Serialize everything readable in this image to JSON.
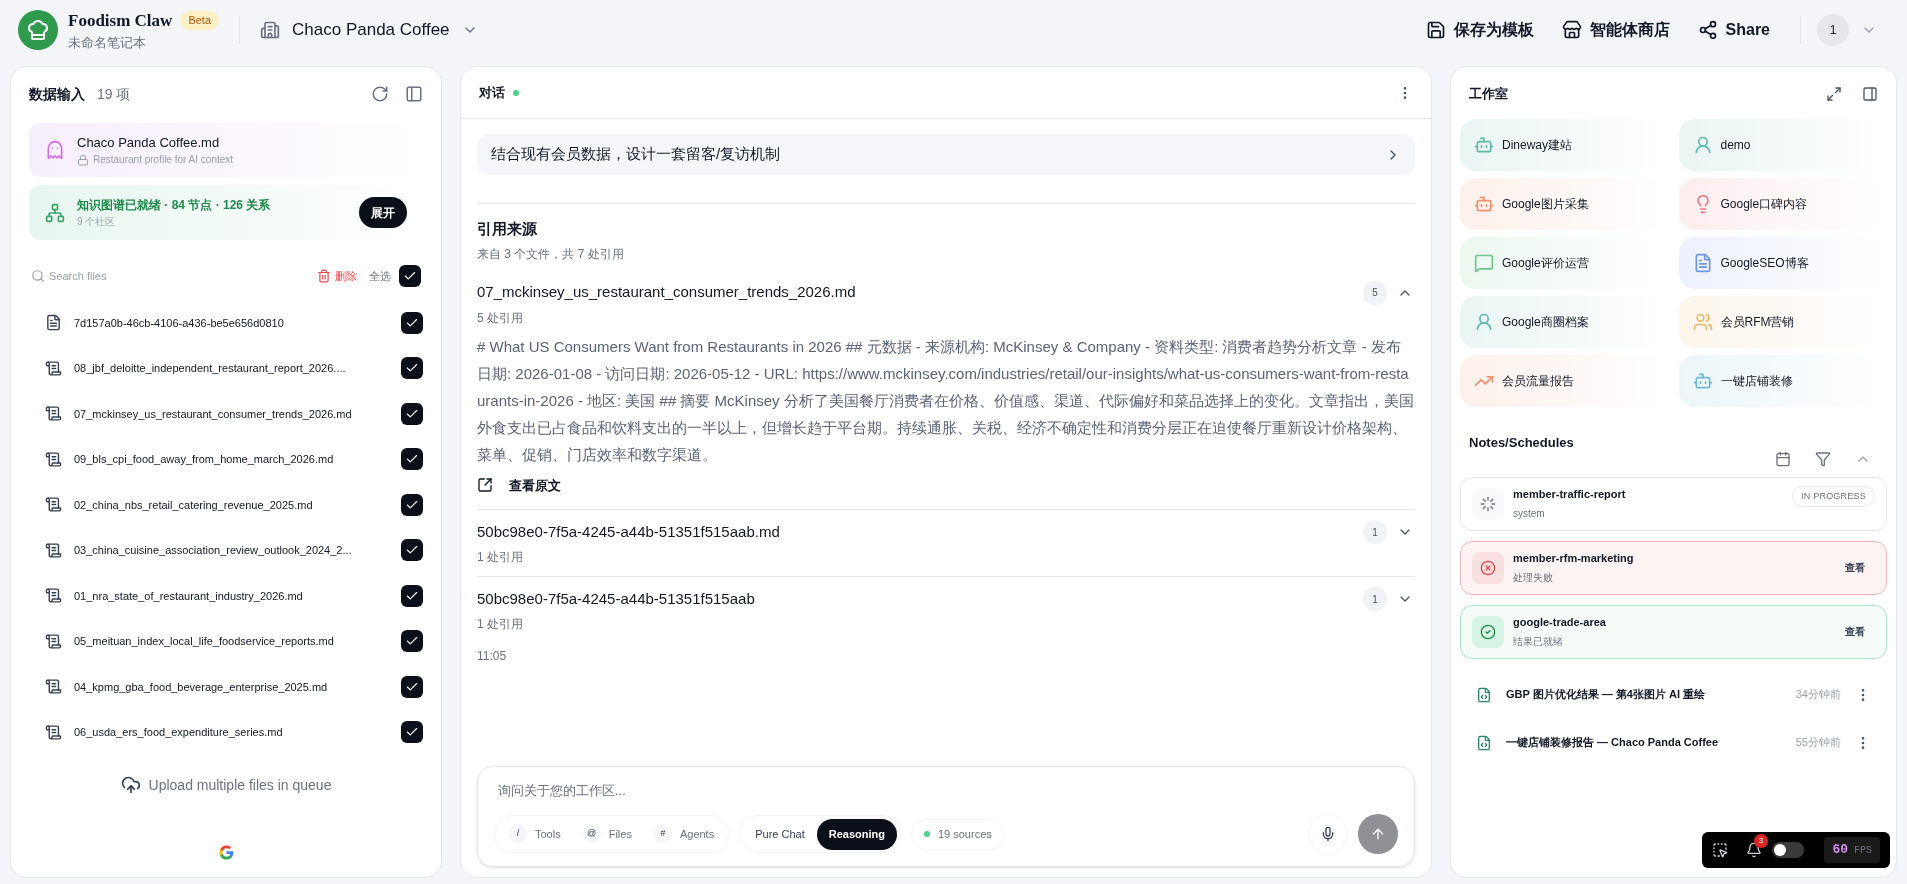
{
  "app": {
    "name": "Foodism Claw",
    "badge": "Beta",
    "notebook": "未命名笔记本",
    "workspace": "Chaco Panda Coffee"
  },
  "header_actions": [
    {
      "kind": "save",
      "label": "保存为模板"
    },
    {
      "kind": "store",
      "label": "智能体商店"
    },
    {
      "kind": "share",
      "label": "Share"
    }
  ],
  "user": {
    "avatar": "1"
  },
  "data_panel": {
    "title": "数据输入",
    "count": "19 项",
    "profile": {
      "name": "Chaco Panda Coffee.md",
      "note": "Restaurant profile for AI context"
    },
    "graph": {
      "status": "知识图谱已就绪 · 84 节点 · 126 关系",
      "communities": "9 个社区",
      "button": "展开"
    },
    "search": {
      "placeholder": "Search files"
    },
    "delete": "删除",
    "select_all": {
      "label": "全选",
      "checked": true
    },
    "files": [
      {
        "kind": "doc",
        "name": "7d157a0b-46cb-4106-a436-be5e656d0810",
        "checked": true
      },
      {
        "kind": "scroll",
        "name": "08_jbf_deloitte_independent_restaurant_report_2026....",
        "checked": true
      },
      {
        "kind": "scroll",
        "name": "07_mckinsey_us_restaurant_consumer_trends_2026.md",
        "checked": true
      },
      {
        "kind": "scroll",
        "name": "09_bls_cpi_food_away_from_home_march_2026.md",
        "checked": true
      },
      {
        "kind": "scroll",
        "name": "02_china_nbs_retail_catering_revenue_2025.md",
        "checked": true
      },
      {
        "kind": "scroll",
        "name": "03_china_cuisine_association_review_outlook_2024_2...",
        "checked": true
      },
      {
        "kind": "scroll",
        "name": "01_nra_state_of_restaurant_industry_2026.md",
        "checked": true
      },
      {
        "kind": "scroll",
        "name": "05_meituan_index_local_life_foodservice_reports.md",
        "checked": true
      },
      {
        "kind": "scroll",
        "name": "04_kpmg_gba_food_beverage_enterprise_2025.md",
        "checked": true
      },
      {
        "kind": "scroll",
        "name": "06_usda_ers_food_expenditure_series.md",
        "checked": true
      }
    ],
    "upload": "Upload multiple files in queue"
  },
  "chat": {
    "title": "对话",
    "online": true,
    "suggestion": "结合现有会员数据，设计一套留客/复访机制",
    "sources_title": "引用来源",
    "sources_summary": "来自 3 个文件，共 7 处引用",
    "sources": [
      {
        "name": "07_mckinsey_us_restaurant_consumer_trends_2026.md",
        "count": "5",
        "refs": "5 处引用",
        "expanded": true,
        "excerpt": "# What US Consumers Want from Restaurants in 2026 ## 元数据 - 来源机构: McKinsey & Company - 资料类型: 消费者趋势分析文章 - 发布日期: 2026-01-08 - 访问日期: 2026-05-12 - URL: https://www.mckinsey.com/industries/retail/our-insights/what-us-consumers-want-from-restaurants-in-2026 - 地区: 美国 ## 摘要 McKinsey 分析了美国餐厅消费者在价格、价值感、渠道、代际偏好和菜品选择上的变化。文章指出，美国外食支出已占食品和饮料支出的一半以上，但增长趋于平台期。持续通胀、关税、经济不确定性和消费分层正在迫使餐厅重新设计价格架构、菜单、促销、门店效率和数字渠道。",
        "link": "查看原文"
      },
      {
        "name": "50bc98e0-7f5a-4245-a44b-51351f515aab.md",
        "count": "1",
        "refs": "1 处引用",
        "expanded": false
      },
      {
        "name": "50bc98e0-7f5a-4245-a44b-51351f515aab",
        "count": "1",
        "refs": "1 处引用",
        "expanded": false
      }
    ],
    "time": "11:05",
    "input": {
      "placeholder": "询问关于您的工作区...",
      "shortcuts": [
        {
          "key": "/",
          "label": "Tools"
        },
        {
          "key": "@",
          "label": "Files"
        },
        {
          "key": "#",
          "label": "Agents"
        }
      ],
      "modes": [
        {
          "label": "Pure Chat",
          "selected": false
        },
        {
          "label": "Reasoning",
          "selected": true
        }
      ],
      "sources": "19 sources"
    }
  },
  "studio": {
    "title": "工作室",
    "tools": [
      {
        "kind": "bot",
        "label": "Dineway建站",
        "color": "#5fb8a8"
      },
      {
        "kind": "profile",
        "label": "demo",
        "color": "#5fb8a8"
      },
      {
        "kind": "bot",
        "label": "Google图片采集",
        "color": "#f0906a"
      },
      {
        "kind": "bulb",
        "label": "Google口碑内容",
        "color": "#ee7a85"
      },
      {
        "kind": "chat",
        "label": "Google评价运营",
        "color": "#6cc68c"
      },
      {
        "kind": "doc",
        "label": "GoogleSEO博客",
        "color": "#6f95e8"
      },
      {
        "kind": "profile",
        "label": "Google商圈档案",
        "color": "#5fb8a8"
      },
      {
        "kind": "users",
        "label": "会员RFM营销",
        "color": "#e8b86a"
      },
      {
        "kind": "trend",
        "label": "会员流量报告",
        "color": "#f0906a"
      },
      {
        "kind": "bot",
        "label": "一键店铺装修",
        "color": "#6fb8d0"
      }
    ],
    "notes_title": "Notes/Schedules",
    "tasks": [
      {
        "kind": "running",
        "name": "member-traffic-report",
        "sub": "system",
        "badge": "IN PROGRESS"
      },
      {
        "kind": "failed",
        "name": "member-rfm-marketing",
        "sub": "处理失败",
        "action": "查看"
      },
      {
        "kind": "done",
        "name": "google-trade-area",
        "sub": "结果已就绪",
        "action": "查看"
      }
    ],
    "notes": [
      {
        "title": "GBP 图片优化结果 — 第4张图片 AI 重绘",
        "time": "34分钟前"
      },
      {
        "title": "一键店铺装修报告 — Chaco Panda Coffee",
        "time": "55分钟前"
      }
    ]
  },
  "dev_toolbar": {
    "notifications": "3",
    "toggle_on": false,
    "fps": "60",
    "fps_unit": "FPS"
  }
}
